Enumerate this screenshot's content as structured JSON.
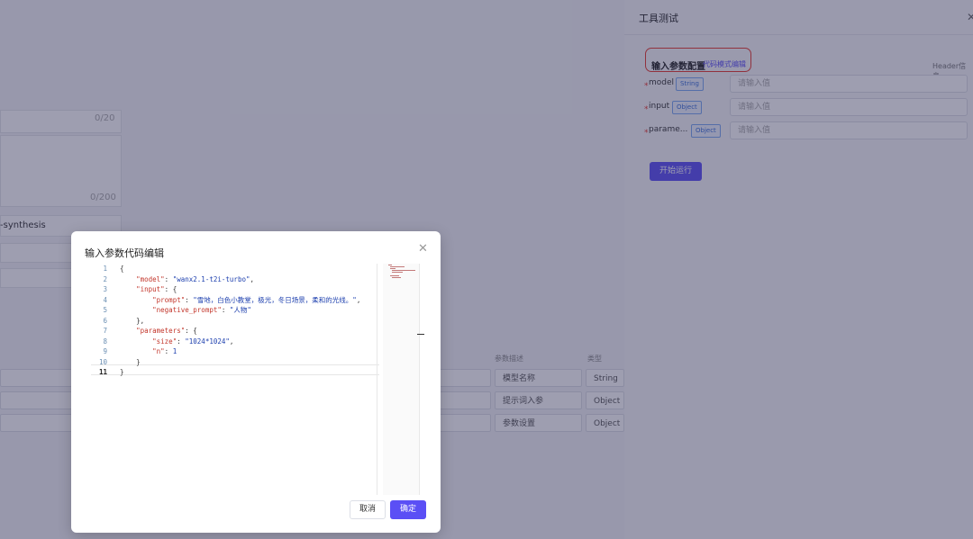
{
  "background": {
    "count1": "0/20",
    "count2": "0/200",
    "model_id_suffix": "-synthesis",
    "table_header_desc": "参数描述",
    "table_header_type": "类型",
    "rows": [
      {
        "desc": "模型名称",
        "type": "String"
      },
      {
        "desc": "提示词入参",
        "type": "Object"
      },
      {
        "desc": "参数设置",
        "type": "Object"
      }
    ]
  },
  "drawer": {
    "title": "工具测试",
    "close": "✕",
    "section_title": "输入参数配置",
    "section_link": "代码模式编辑",
    "header_info": "Header信息",
    "params": [
      {
        "req": "*",
        "name": "model",
        "type": "String",
        "placeholder": "请输入值"
      },
      {
        "req": "*",
        "name": "input",
        "type": "Object",
        "placeholder": "请输入值"
      },
      {
        "req": "*",
        "name": "parame...",
        "type": "Object",
        "placeholder": "请输入值"
      }
    ],
    "run_label": "开始运行"
  },
  "modal": {
    "title": "输入参数代码编辑",
    "close": "✕",
    "cancel_label": "取消",
    "ok_label": "确定",
    "code_lines": [
      {
        "n": "1",
        "text": "{"
      },
      {
        "n": "2",
        "text": "    \"model\": \"wanx2.1-t2i-turbo\","
      },
      {
        "n": "3",
        "text": "    \"input\": {"
      },
      {
        "n": "4",
        "text": "        \"prompt\": \"雪地，白色小教堂，极光，冬日场景，柔和的光线。\","
      },
      {
        "n": "5",
        "text": "        \"negative_prompt\": \"人物\""
      },
      {
        "n": "6",
        "text": "    },"
      },
      {
        "n": "7",
        "text": "    \"parameters\": {"
      },
      {
        "n": "8",
        "text": "        \"size\": \"1024*1024\","
      },
      {
        "n": "9",
        "text": "        \"n\": 1"
      },
      {
        "n": "10",
        "text": "    }"
      },
      {
        "n": "11",
        "text": "}"
      }
    ]
  },
  "colors": {
    "accent": "#5b4ff5",
    "highlight_border": "#e8392f",
    "tag_blue": "#3a6fd8"
  }
}
